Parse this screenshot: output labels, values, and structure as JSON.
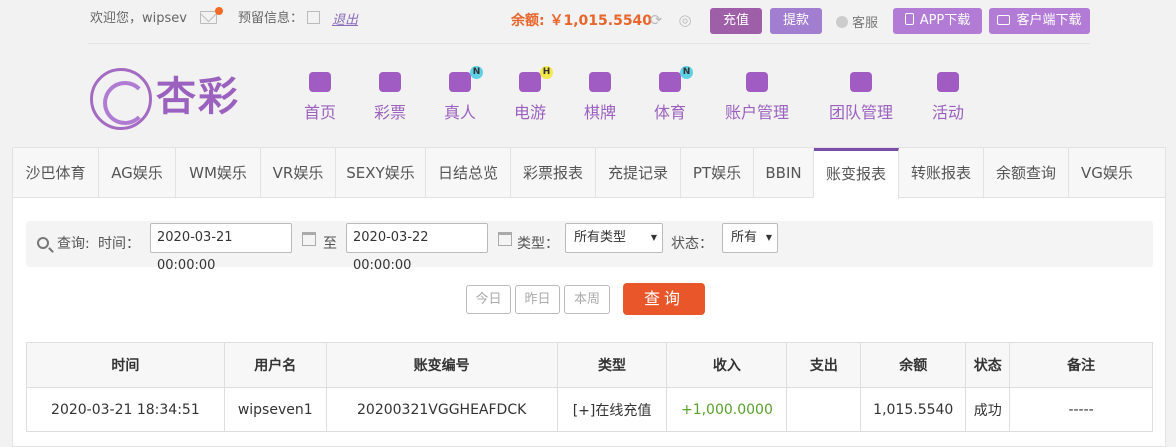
{
  "top": {
    "welcome": "欢迎您，wipsev",
    "reserved_info": "预留信息：",
    "logout": "退出",
    "balance": "余额: ￥1,015.5540",
    "recharge": "充值",
    "withdraw": "提款",
    "service": "客服",
    "app_download": "APP下载",
    "client_download": "客户端下载"
  },
  "logo": {
    "text": "杏彩"
  },
  "nav": [
    {
      "label": "首页",
      "badge": ""
    },
    {
      "label": "彩票",
      "badge": ""
    },
    {
      "label": "真人",
      "badge": "N"
    },
    {
      "label": "电游",
      "badge": "H"
    },
    {
      "label": "棋牌",
      "badge": ""
    },
    {
      "label": "体育",
      "badge": "N"
    },
    {
      "label": "账户管理",
      "badge": ""
    },
    {
      "label": "团队管理",
      "badge": ""
    },
    {
      "label": "活动",
      "badge": ""
    }
  ],
  "tabs": [
    "沙巴体育",
    "AG娱乐",
    "WM娱乐",
    "VR娱乐",
    "SEXY娱乐",
    "日结总览",
    "彩票报表",
    "充提记录",
    "PT娱乐",
    "BBIN",
    "账变报表",
    "转账报表",
    "余额查询",
    "VG娱乐"
  ],
  "active_tab": "账变报表",
  "search": {
    "query_label": "查询:",
    "time_label": "时间：",
    "start": "2020-03-21 00:00:00",
    "to": "至",
    "end": "2020-03-22 00:00:00",
    "type_label": "类型：",
    "type_value": "所有类型",
    "status_label": "状态：",
    "status_value": "所有"
  },
  "quick": {
    "today": "今日",
    "yesterday": "昨日",
    "week": "本周",
    "query": "查询"
  },
  "table": {
    "headers": [
      "时间",
      "用户名",
      "账变编号",
      "类型",
      "收入",
      "支出",
      "余额",
      "状态",
      "备注"
    ],
    "rows": [
      [
        "2020-03-21 18:34:51",
        "wipseven1",
        "20200321VGGHEAFDCK",
        "[+]在线充值",
        "+1,000.0000",
        "",
        "1,015.5540",
        "成功",
        "-----"
      ]
    ]
  },
  "colors": {
    "brand": "#9b61bf",
    "accent": "#e8562a",
    "income": "#5aa02c"
  }
}
